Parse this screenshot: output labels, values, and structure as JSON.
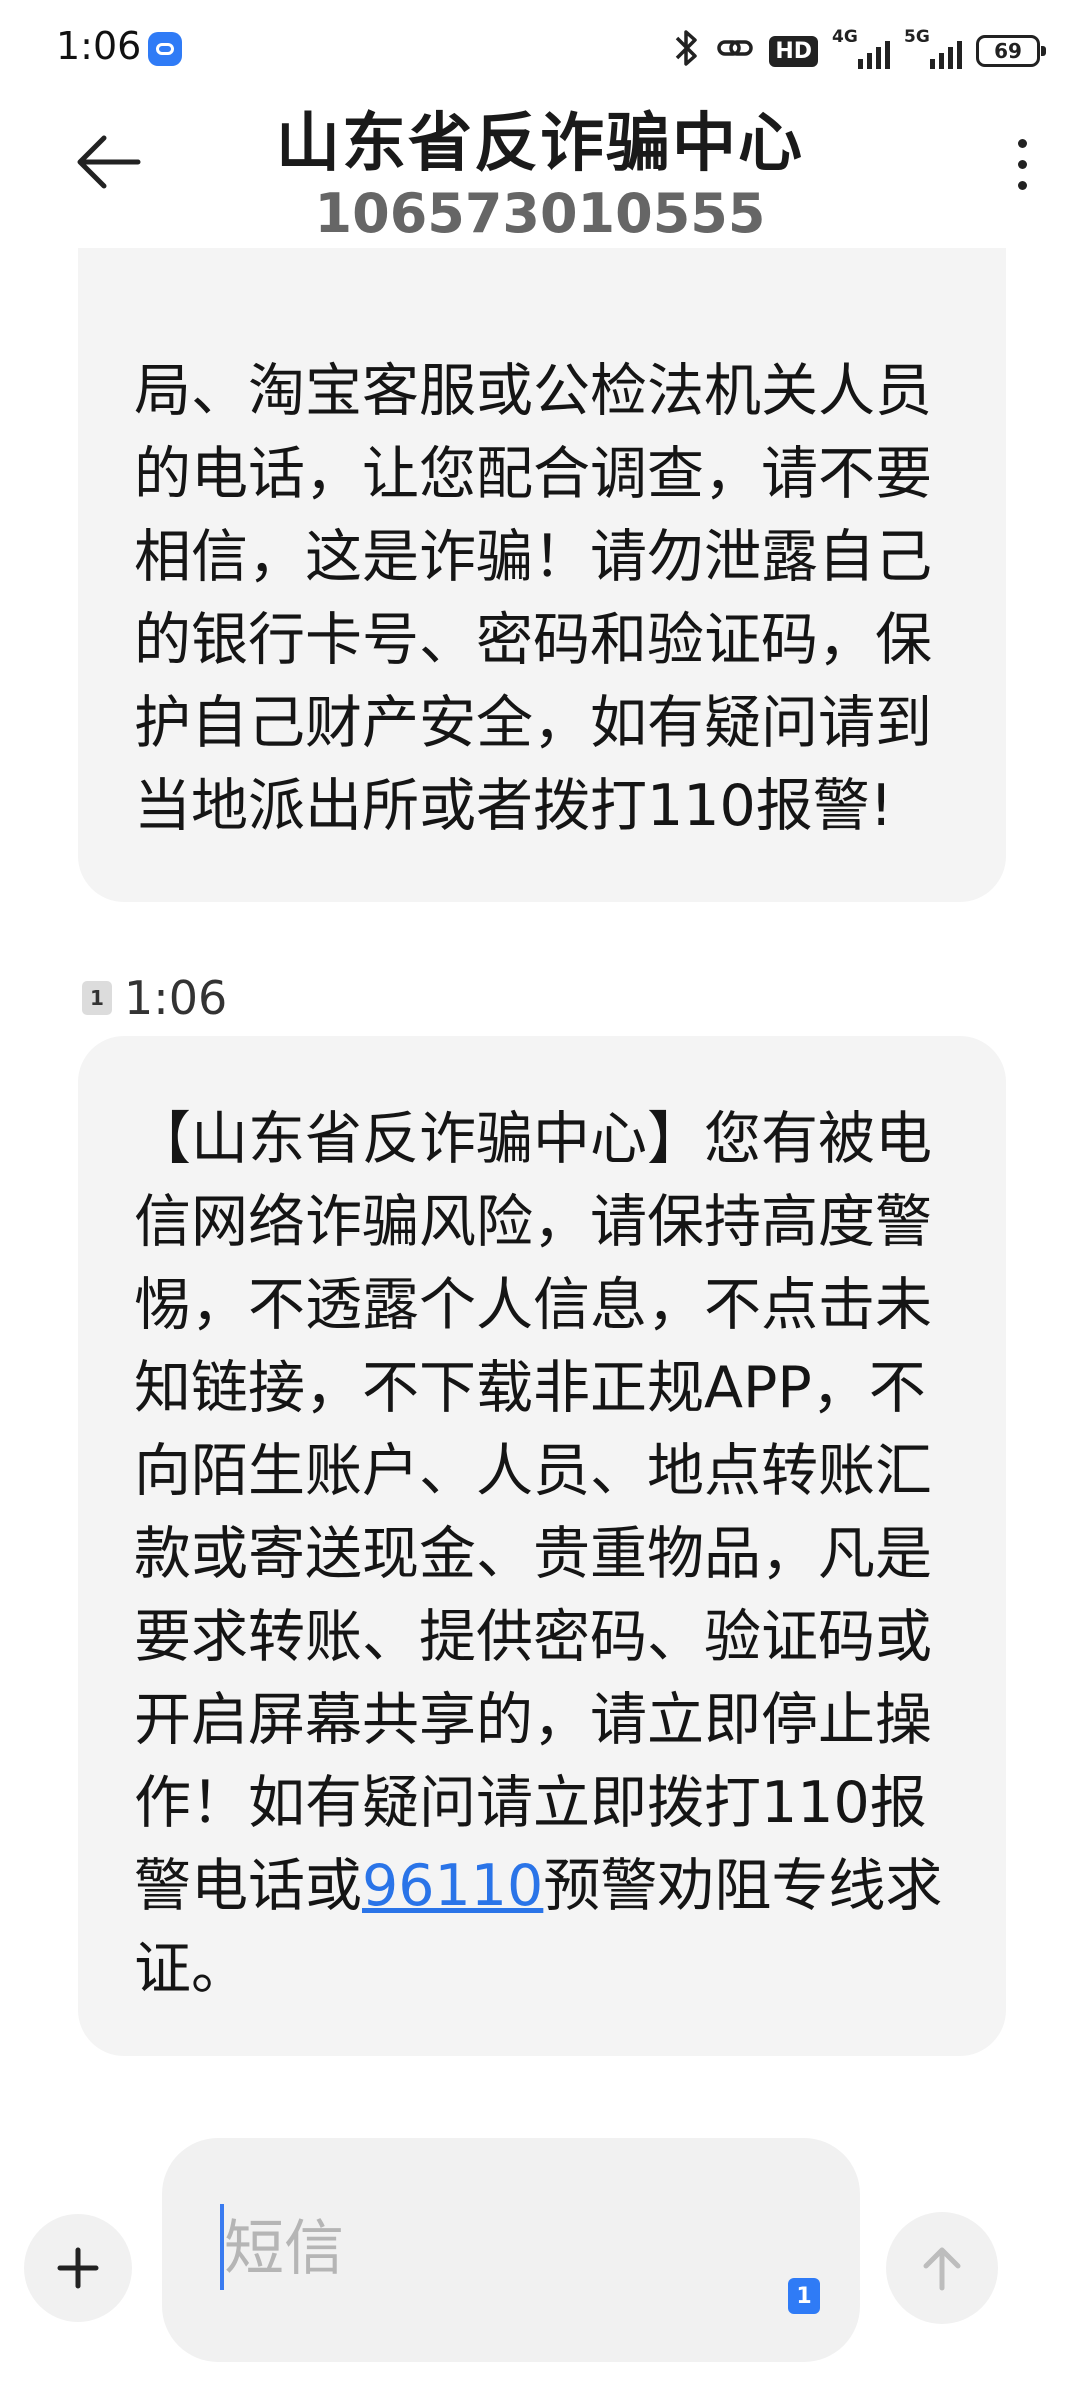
{
  "status_bar": {
    "time": "1:06",
    "hd_label": "HD",
    "signal_1_label": "4G",
    "signal_2_label": "5G",
    "battery": "69"
  },
  "header": {
    "contact_name": "山东省反诈骗中心",
    "contact_number": "106573010555"
  },
  "messages": [
    {
      "text": "局、淘宝客服或公检法机关人员的电话，让您配合调查，请不要相信，这是诈骗！请勿泄露自己的银行卡号、密码和验证码，保护自己财产安全，如有疑问请到当地派出所或者拨打110报警!"
    },
    {
      "sim": "1",
      "time": "1:06",
      "text_before_link": "【山东省反诈骗中心】您有被电信网络诈骗风险，请保持高度警惕，不透露个人信息，不点击未知链接，不下载非正规APP，不向陌生账户、人员、地点转账汇款或寄送现金、贵重物品，凡是要求转账、提供密码、验证码或开启屏幕共享的，请立即停止操作！如有疑问请立即拨打110报警电话或",
      "link": "96110",
      "text_after_link": "预警劝阻专线求证。"
    }
  ],
  "composer": {
    "placeholder": "短信",
    "sim": "1"
  },
  "icons": {
    "back": "back-arrow-icon",
    "more": "more-vertical-icon",
    "add": "plus-icon",
    "send": "send-arrow-icon",
    "bluetooth": "bluetooth-icon",
    "link": "link-icon"
  },
  "colors": {
    "bubble": "#f4f4f4",
    "link": "#2a74e8",
    "accent": "#2f7bf6"
  }
}
